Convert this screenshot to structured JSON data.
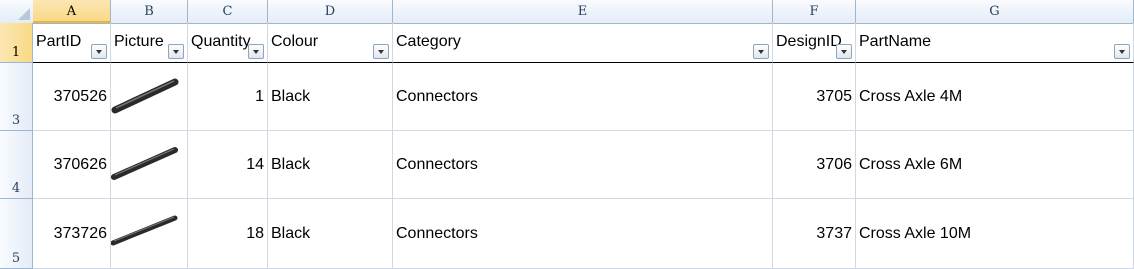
{
  "column_letters": [
    "A",
    "B",
    "C",
    "D",
    "E",
    "F",
    "G"
  ],
  "row_numbers": [
    "1",
    "3",
    "4",
    "5"
  ],
  "headers": [
    "PartID",
    "Picture",
    "Quantity",
    "Colour",
    "Category",
    "DesignID",
    "PartName"
  ],
  "rows": [
    {
      "partid": "370526",
      "picture_icon": "cross-axle-4m-image",
      "quantity": "1",
      "colour": "Black",
      "category": "Connectors",
      "designid": "3705",
      "partname": "Cross Axle 4M"
    },
    {
      "partid": "370626",
      "picture_icon": "cross-axle-6m-image",
      "quantity": "14",
      "colour": "Black",
      "category": "Connectors",
      "designid": "3706",
      "partname": "Cross Axle 6M"
    },
    {
      "partid": "373726",
      "picture_icon": "cross-axle-10m-image",
      "quantity": "18",
      "colour": "Black",
      "category": "Connectors",
      "designid": "3737",
      "partname": "Cross Axle 10M"
    }
  ],
  "colors": {
    "grid": "#d0d7e5",
    "header_border": "#9eb6ce",
    "selected_header": "#f9d985"
  }
}
